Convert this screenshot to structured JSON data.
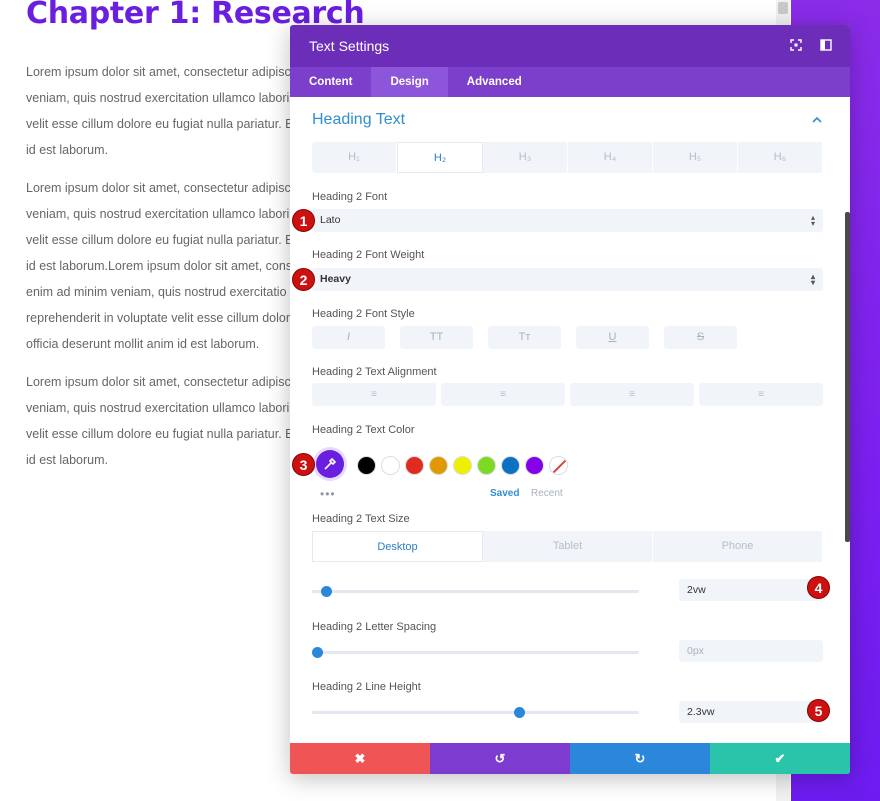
{
  "background": {
    "heading": "Chapter 1: Research",
    "paragraphs": [
      [
        "Lorem ipsum dolor sit amet, consectetur adipiscing",
        "veniam, quis nostrud exercitation ullamco laboris",
        "velit esse cillum dolore eu fugiat nulla pariatur. Ex",
        "id est laborum."
      ],
      [
        "Lorem ipsum dolor sit amet, consectetur adipiscing",
        "veniam, quis nostrud exercitation ullamco laboris",
        "velit esse cillum dolore eu fugiat nulla pariatur. Ex",
        "id est laborum.Lorem ipsum dolor sit amet, consec",
        "enim ad minim veniam, quis nostrud exercitatio",
        "reprehenderit in voluptate velit esse cillum dolore",
        "officia deserunt mollit anim id est laborum."
      ],
      [
        "Lorem ipsum dolor sit amet, consectetur adipiscing",
        "veniam, quis nostrud exercitation ullamco laboris",
        "velit esse cillum dolore eu fugiat nulla pariatur. Ex",
        "id est laborum."
      ]
    ]
  },
  "modal": {
    "title": "Text Settings",
    "header_icons": [
      "fullscreen-icon",
      "sidebar-toggle-icon"
    ],
    "tabs": [
      {
        "label": "Content",
        "active": false
      },
      {
        "label": "Design",
        "active": true
      },
      {
        "label": "Advanced",
        "active": false
      }
    ],
    "section_title": "Heading Text",
    "heading_tabs": [
      "H₁",
      "H₂",
      "H₃",
      "H₄",
      "H₅",
      "H₆"
    ],
    "active_heading_tab": 1,
    "font_label": "Heading 2 Font",
    "font_value": "Lato",
    "weight_label": "Heading 2 Font Weight",
    "weight_value": "Heavy",
    "style_label": "Heading 2 Font Style",
    "style_buttons": [
      "I",
      "TT",
      "Tт",
      "U",
      "S"
    ],
    "align_label": "Heading 2 Text Alignment",
    "align_buttons": [
      "≡",
      "≡",
      "≡",
      "≡"
    ],
    "color_label": "Heading 2 Text Color",
    "picker_color": "#6a1ee0",
    "swatches": [
      "#000000",
      "#ffffff",
      "#e02b20",
      "#e09900",
      "#edf000",
      "#7cda24",
      "#0c71c3",
      "#8300e9"
    ],
    "saved_label": "Saved",
    "recent_label": "Recent",
    "more_label": "•••",
    "size_label": "Heading 2 Text Size",
    "device_tabs": [
      "Desktop",
      "Tablet",
      "Phone"
    ],
    "active_device_tab": 0,
    "size_value": "2vw",
    "size_slider": 0.03,
    "letter_label": "Heading 2 Letter Spacing",
    "letter_value": "0px",
    "letter_slider": 0.0,
    "line_label": "Heading 2 Line Height",
    "line_value": "2.3vw",
    "line_slider": 0.64,
    "footer": {
      "cancel": "✖",
      "undo": "↺",
      "redo": "↻",
      "save": "✔"
    }
  },
  "markers": [
    "1",
    "2",
    "3",
    "4",
    "5"
  ]
}
